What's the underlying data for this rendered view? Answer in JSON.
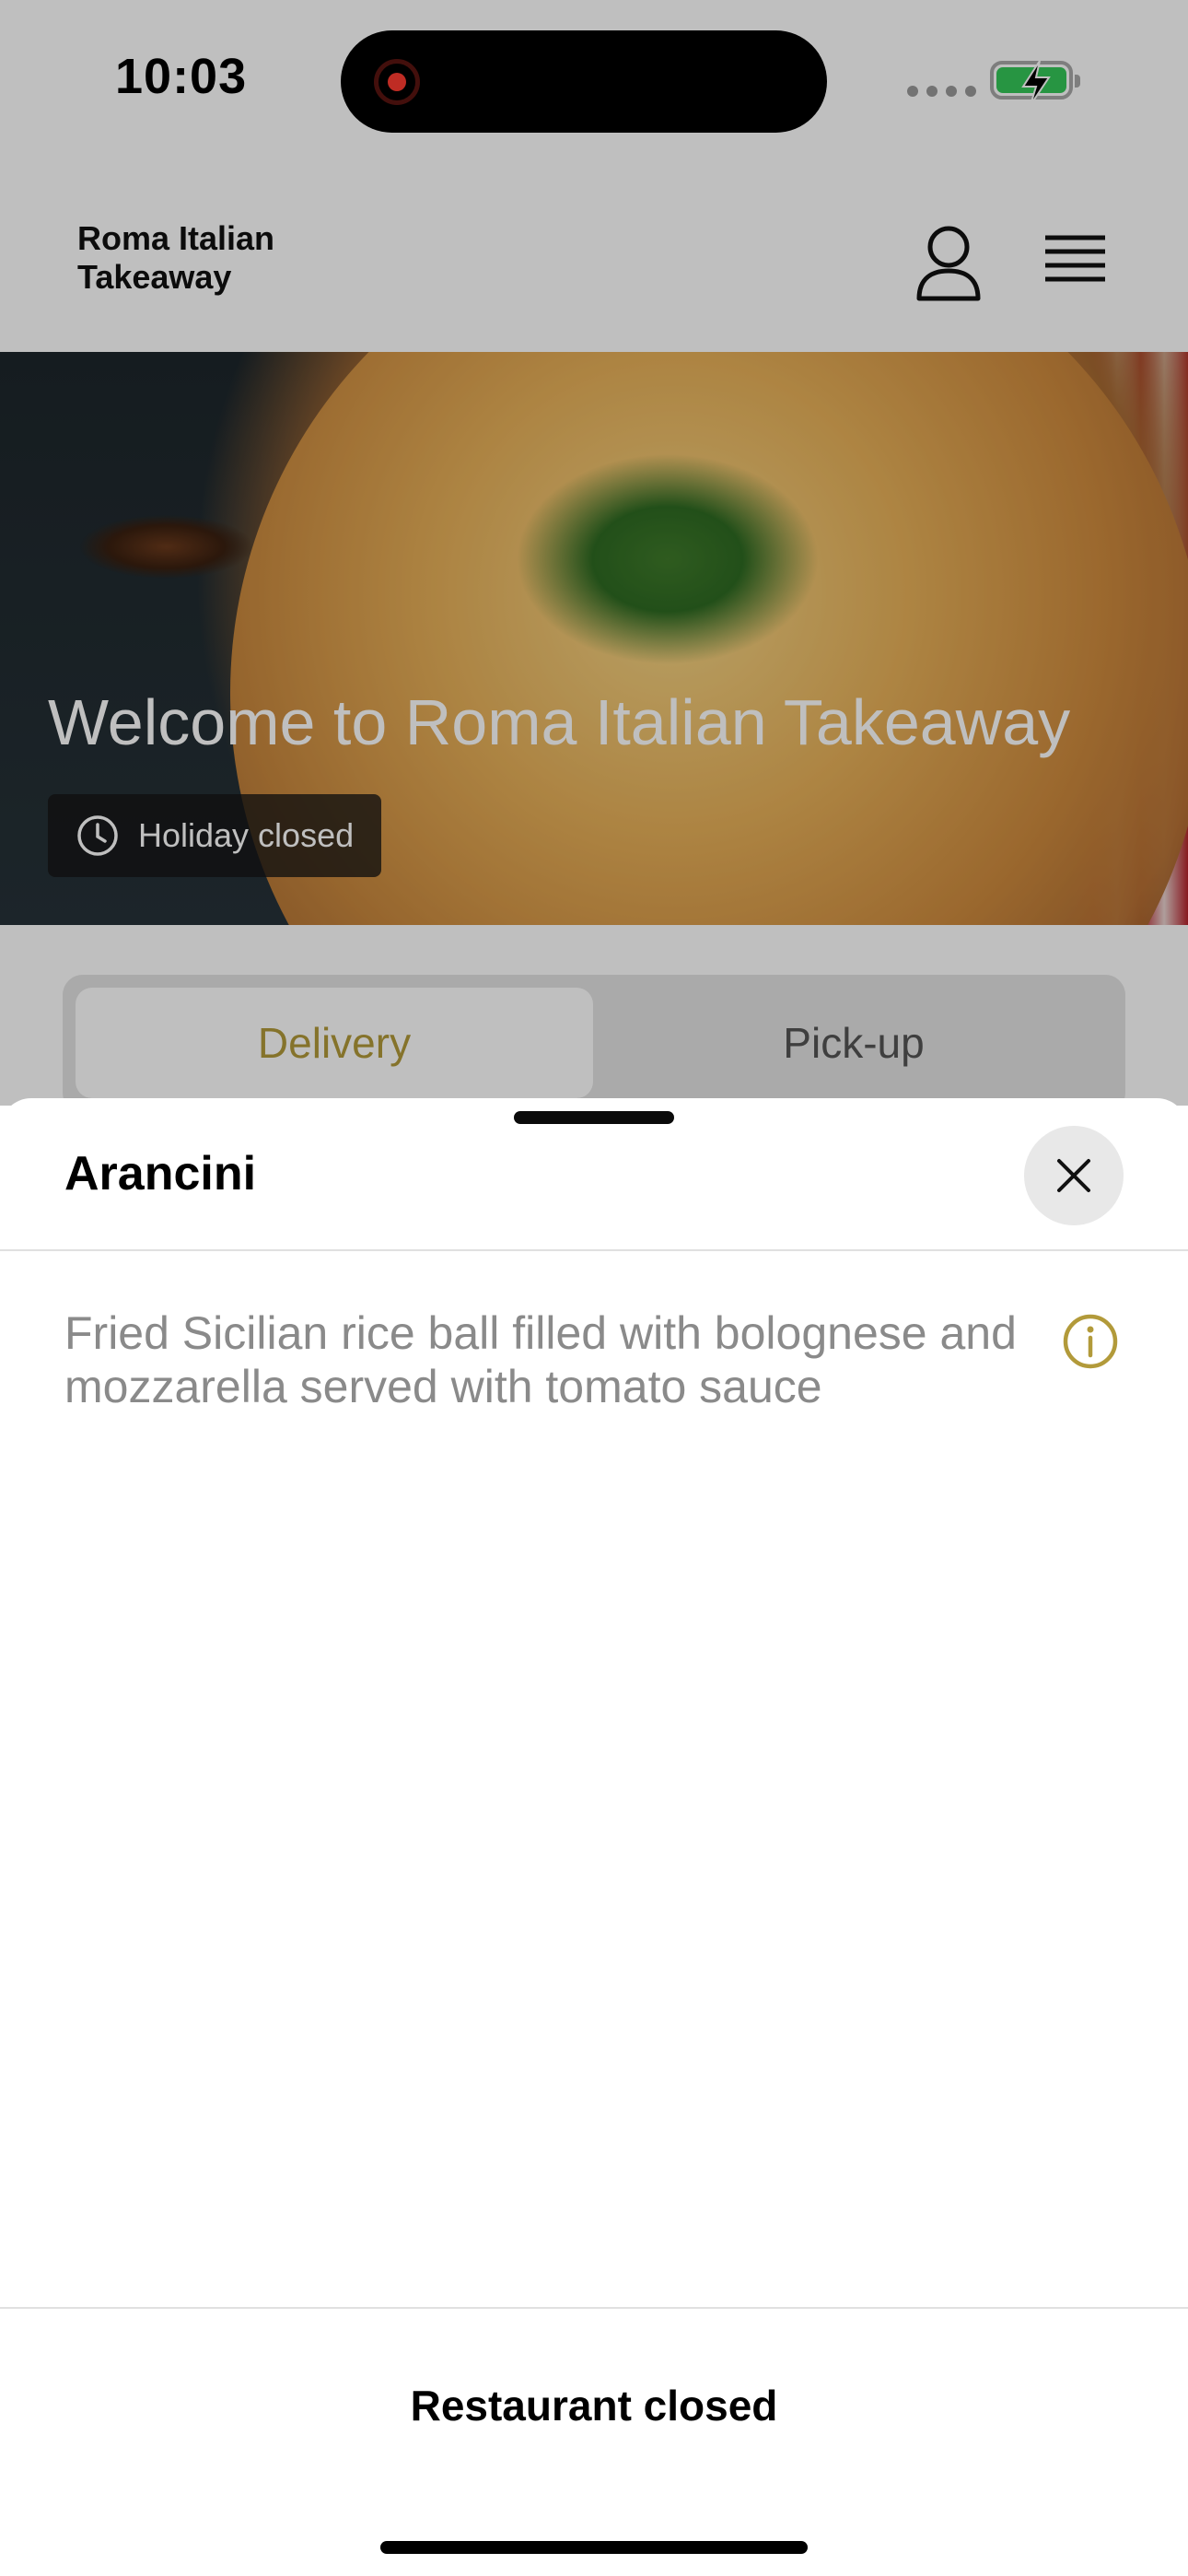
{
  "status_bar": {
    "time": "10:03",
    "icons": [
      "screen-recording-icon",
      "signal-icon",
      "battery-charging-icon"
    ],
    "battery_color": "#34c759",
    "recording_color": "#ff3b30"
  },
  "app_bar": {
    "title": "Roma Italian Takeaway",
    "icons": [
      "user-icon",
      "hamburger-menu-icon"
    ]
  },
  "hero": {
    "title": "Welcome to Roma Italian Takeaway",
    "status_badge": "Holiday closed",
    "status_icon": "clock-icon"
  },
  "order_type_tabs": {
    "items": [
      {
        "label": "Delivery",
        "selected": true
      },
      {
        "label": "Pick-up",
        "selected": false
      }
    ],
    "accent_color": "#b29a3a"
  },
  "item_sheet": {
    "title": "Arancini",
    "description": "Fried Sicilian rice ball filled with bolognese and mozzarella served with tomato sauce",
    "info_icon": "info-icon",
    "close_icon": "close-icon",
    "footer_label": "Restaurant closed"
  }
}
